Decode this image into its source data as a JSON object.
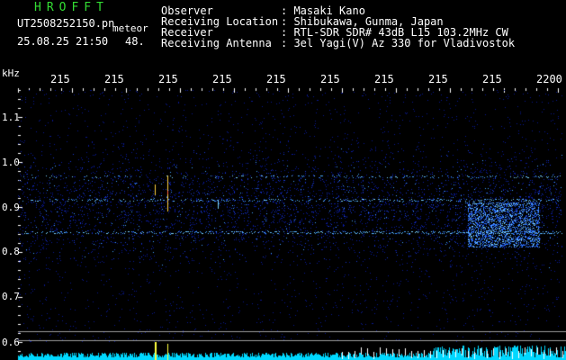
{
  "app_title": "HROFFT",
  "file_name": "UT2508252150.pn",
  "file_suffix": "meteor",
  "timestamp": "25.08.25 21:50",
  "count": "48.",
  "info": [
    {
      "label": "Observer",
      "value": ": Masaki Kano"
    },
    {
      "label": "Receiving Location",
      "value": ": Shibukawa, Gunma, Japan"
    },
    {
      "label": "Receiver",
      "value": ": RTL-SDR SDR# 43dB L15 103.2MHz CW"
    },
    {
      "label": "Receiving Antenna",
      "value": ": 3el Yagi(V) Az 330 for Vladivostok"
    }
  ],
  "y_unit": "kHz",
  "x_ticks": [
    "215",
    "215",
    "215",
    "215",
    "215",
    "215",
    "215",
    "215",
    "215",
    "2200"
  ],
  "y_ticks": [
    "1.1",
    "1.0",
    "0.9",
    "0.8",
    "0.7",
    "0.6"
  ],
  "colors": {
    "background": "#000000",
    "title": "#33dd33",
    "text": "#ffffff",
    "band_low": "#0a1aa0",
    "band_high": "#40a0ff",
    "echo_line": "#7ad0ff",
    "meteor_echo": "#ffd040",
    "bottom_bar": "#00d8ff"
  }
}
